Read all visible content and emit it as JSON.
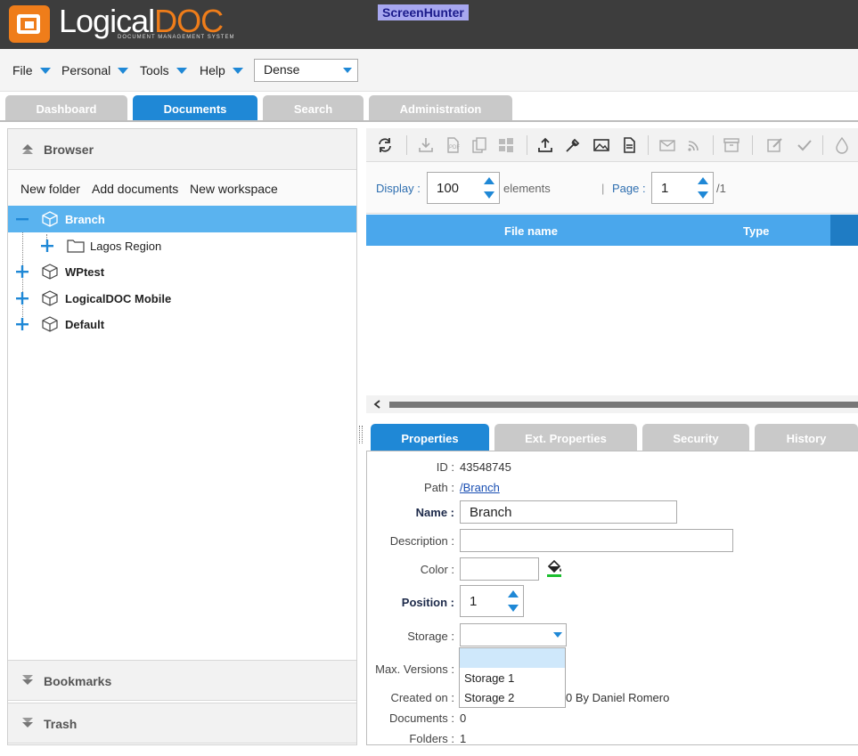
{
  "app": {
    "logo_light": "Logical",
    "logo_accent": "DOC",
    "logo_sub": "DOCUMENT MANAGEMENT SYSTEM",
    "badge": "ScreenHunter"
  },
  "menu": {
    "items": [
      "File",
      "Personal",
      "Tools",
      "Help"
    ],
    "density": "Dense"
  },
  "tabs": [
    "Dashboard",
    "Documents",
    "Search",
    "Administration"
  ],
  "active_tab": "Documents",
  "browser": {
    "title": "Browser",
    "actions": [
      "New folder",
      "Add documents",
      "New workspace"
    ],
    "tree": {
      "selected": "Branch",
      "child": "Lagos Region",
      "others": [
        "WPtest",
        "LogicalDOC Mobile",
        "Default"
      ]
    },
    "bookmarks": "Bookmarks",
    "trash": "Trash"
  },
  "paging": {
    "display_label": "Display :",
    "display_value": "100",
    "elements_label": "elements",
    "page_label": "Page :",
    "page_value": "1",
    "page_total": "/1"
  },
  "grid": {
    "columns": [
      "File name",
      "Type"
    ]
  },
  "subtabs": [
    "Properties",
    "Ext. Properties",
    "Security",
    "History"
  ],
  "properties": {
    "id_label": "ID :",
    "id_value": "43548745",
    "path_label": "Path :",
    "path_value": "/Branch",
    "name_label": "Name :",
    "name_value": "Branch",
    "description_label": "Description :",
    "description_value": "",
    "color_label": "Color :",
    "color_value": "",
    "position_label": "Position :",
    "position_value": "1",
    "storage_label": "Storage :",
    "storage_options": [
      "Storage 1",
      "Storage 2"
    ],
    "maxversions_label": "Max. Versions :",
    "createdon_label": "Created on :",
    "createdon_value": "0 By Daniel Romero",
    "documents_label": "Documents :",
    "documents_value": "0",
    "folders_label": "Folders :",
    "folders_value": "1"
  },
  "colors": {
    "accent_blue": "#1f88d6",
    "selection_blue": "#5ab3ef",
    "brand_orange": "#ef7d1a",
    "header_dark": "#3d3d3d"
  }
}
